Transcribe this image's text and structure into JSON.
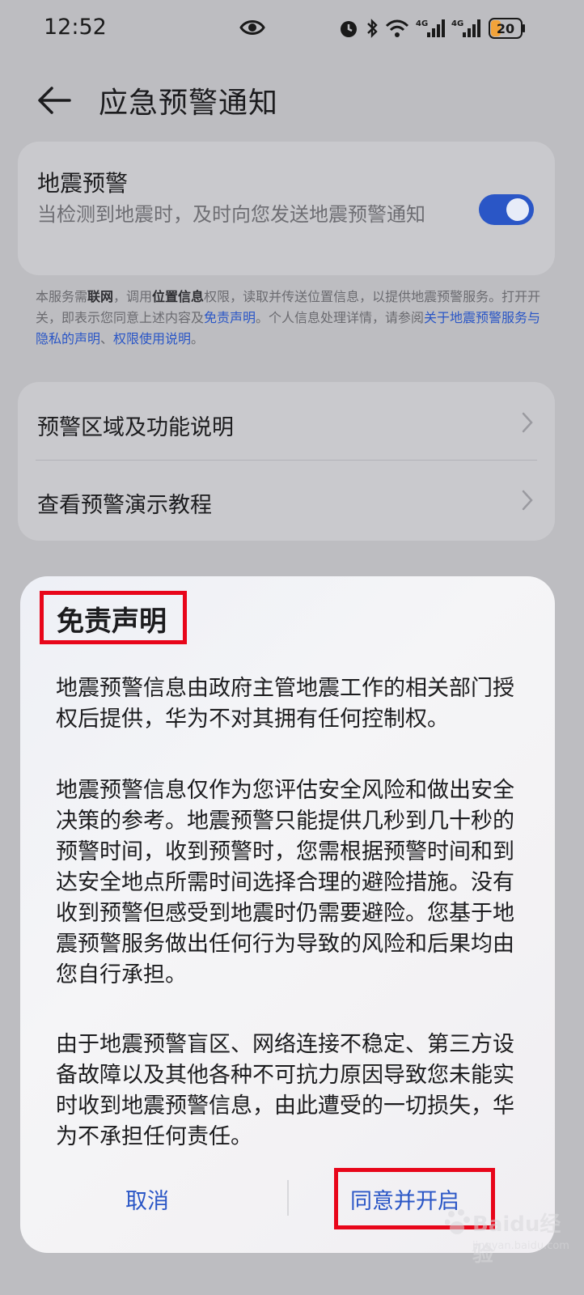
{
  "status_bar": {
    "time": "12:52",
    "battery": "20",
    "network_1": "4G",
    "network_2": "4G",
    "icons": [
      "eye-icon",
      "alarm-icon",
      "bluetooth-icon",
      "wifi-icon",
      "signal-icon",
      "signal-icon",
      "battery-icon"
    ]
  },
  "header": {
    "title": "应急预警通知",
    "back_icon": "arrow-left-icon"
  },
  "earthquake_card": {
    "title": "地震预警",
    "description": "当检测到地震时，及时向您发送地震预警通知",
    "toggle_on": true,
    "accent": "#2a56c6"
  },
  "notice": {
    "t1": "本服务需",
    "b1": "联网",
    "t2": "，调用",
    "b2": "位置信息",
    "t3": "权限，读取并传送位置信息，以提供地震预警服务。打开开关，即表示您同意上述内容及",
    "link1": "免责声明",
    "t4": "。个人信息处理详情，请参阅",
    "link2": "关于地震预警服务与隐私的声明",
    "t5": "、",
    "link3": "权限使用说明",
    "t6": "。"
  },
  "menu": {
    "items": [
      {
        "label": "预警区域及功能说明"
      },
      {
        "label": "查看预警演示教程"
      }
    ]
  },
  "dialog": {
    "title": "免责声明",
    "paragraphs": [
      "地震预警信息由政府主管地震工作的相关部门授权后提供，华为不对其拥有任何控制权。",
      "地震预警信息仅作为您评估安全风险和做出安全决策的参考。地震预警只能提供几秒到几十秒的预警时间，收到预警时，您需根据预警时间和到达安全地点所需时间选择合理的避险措施。没有收到预警但感受到地震时仍需要避险。您基于地震预警服务做出任何行为导致的风险和后果均由您自行承担。",
      "由于地震预警盲区、网络连接不稳定、第三方设备故障以及其他各种不可抗力原因导致您未能实时收到地震预警信息，由此遭受的一切损失，华为不承担任何责任。"
    ],
    "cancel_label": "取消",
    "agree_label": "同意并开启",
    "highlight_color": "#e8061a"
  },
  "watermark": {
    "text": "Baidu经验",
    "sub": "jingyan.baidu.com"
  }
}
